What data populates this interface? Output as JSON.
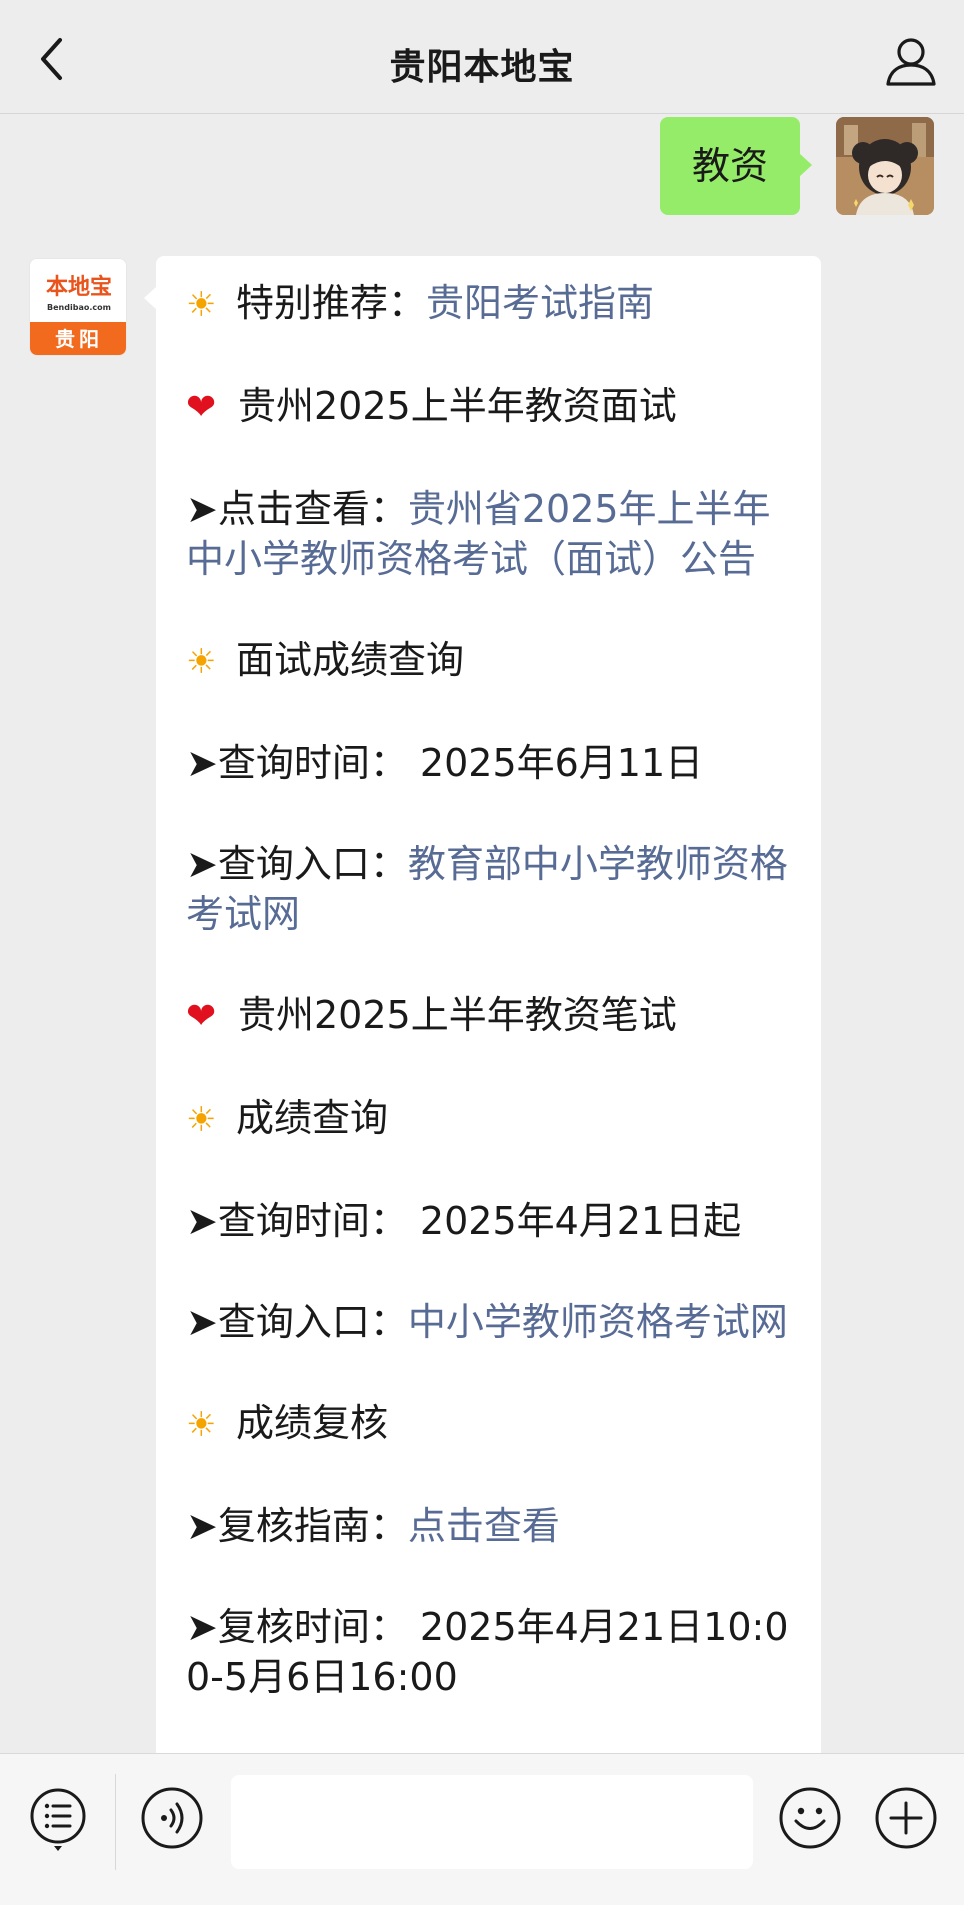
{
  "header": {
    "title": "贵阳本地宝"
  },
  "outgoing": {
    "text": "教资"
  },
  "official_avatar": {
    "logo_main": "本地宝",
    "logo_sub": "Bendibao.com",
    "city": "贵阳"
  },
  "message": {
    "l1_label": "特别推荐：",
    "l1_link": "贵阳考试指南",
    "l2_text": "贵州2025上半年教资面试",
    "l3_label": "➤点击查看：",
    "l3_link": "贵州省2025年上半年中小学教师资格考试（面试）公告",
    "l4_text": "面试成绩查询",
    "l5_text": "➤查询时间： 2025年6月11日",
    "l6_label": "➤查询入口：",
    "l6_link": "教育部中小学教师资格考试网",
    "l7_text": "贵州2025上半年教资笔试",
    "l8_text": "成绩查询",
    "l9_text": "➤查询时间： 2025年4月21日起",
    "l10_label": "➤查询入口：",
    "l10_link": "中小学教师资格考试网",
    "l11_text": "成绩复核",
    "l12_label": "➤复核指南：",
    "l12_link": "点击查看",
    "l13_text": "➤复核时间： 2025年4月21日10:00-5月6日16:00"
  },
  "icons": {
    "back": "chevron-left-icon",
    "profile": "user-icon",
    "menu": "list-menu-icon",
    "voice": "voice-icon",
    "emoji": "emoji-icon",
    "plus": "plus-icon",
    "sun": "sun-emoji",
    "heart": "red-heart-emoji"
  },
  "colors": {
    "link": "#576b95",
    "outgoing_bubble": "#95ec69",
    "background": "#ededed"
  }
}
